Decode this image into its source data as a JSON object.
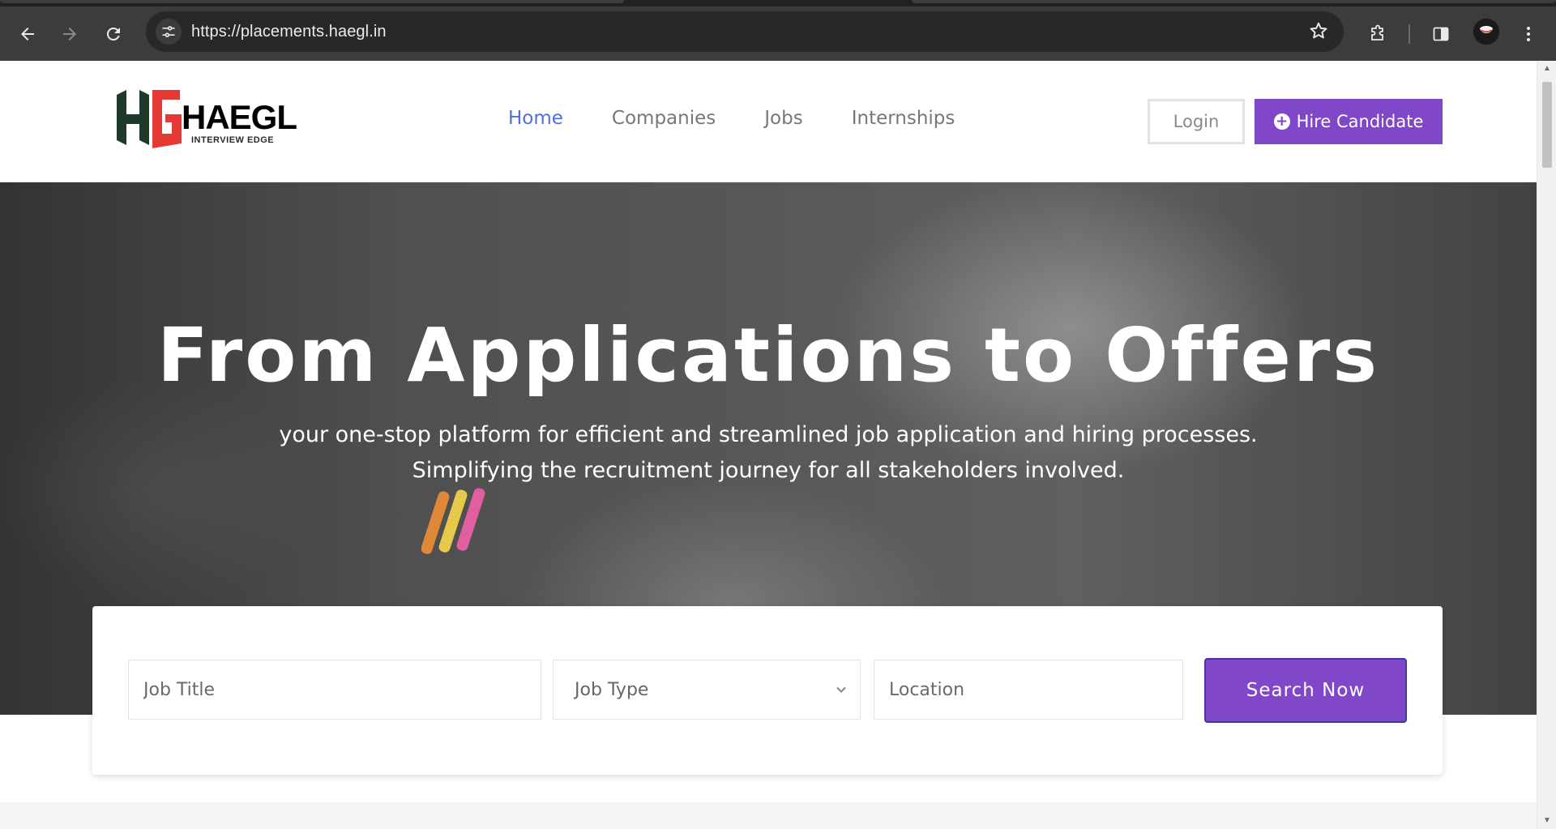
{
  "browser": {
    "url": "https://placements.haegl.in",
    "icons": {
      "back": "arrow-left-icon",
      "forward": "arrow-right-icon",
      "reload": "reload-icon",
      "site_info": "tune-icon",
      "bookmark": "star-icon",
      "extensions": "puzzle-icon",
      "side_panel": "side-panel-icon",
      "menu": "kebab-menu-icon"
    }
  },
  "header": {
    "logo": {
      "text_main": "HAEGL",
      "text_sub": "INTERVIEW EDGE",
      "mark": "HG"
    },
    "nav": [
      {
        "label": "Home",
        "active": true
      },
      {
        "label": "Companies",
        "active": false
      },
      {
        "label": "Jobs",
        "active": false
      },
      {
        "label": "Internships",
        "active": false
      }
    ],
    "login_label": "Login",
    "hire_label": "Hire Candidate"
  },
  "hero": {
    "title": "From Applications to Offers",
    "subtitle_line1": "your one-stop platform for efficient and streamlined job application and hiring processes.",
    "subtitle_line2": "Simplifying the recruitment journey for all stakeholders involved."
  },
  "search": {
    "job_title_placeholder": "Job Title",
    "job_type_selected": "Job Type",
    "location_placeholder": "Location",
    "button_label": "Search Now"
  },
  "colors": {
    "accent": "#8147c9",
    "nav_active": "#4f6fe0",
    "logo_red": "#e53935",
    "logo_green": "#1e3a2a"
  }
}
